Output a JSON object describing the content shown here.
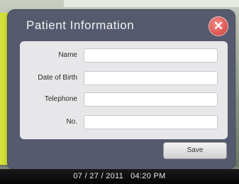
{
  "dialog": {
    "title": "Patient Information",
    "close_icon": "close-icon",
    "fields": [
      {
        "label": "Name",
        "value": "",
        "placeholder": ""
      },
      {
        "label": "Date of Birth",
        "value": "",
        "placeholder": ""
      },
      {
        "label": "Telephone",
        "value": "",
        "placeholder": ""
      },
      {
        "label": "No.",
        "value": "",
        "placeholder": ""
      }
    ],
    "save_label": "Save"
  },
  "status": {
    "datetime": "07 / 27 / 2011   04:20 PM"
  },
  "colors": {
    "dialog_bg": "#565a6e",
    "form_bg": "#e7e7e9",
    "close_red": "#d9534f",
    "accent_yellow": "#d6e23a",
    "status_bg": "#0a0a0a"
  }
}
